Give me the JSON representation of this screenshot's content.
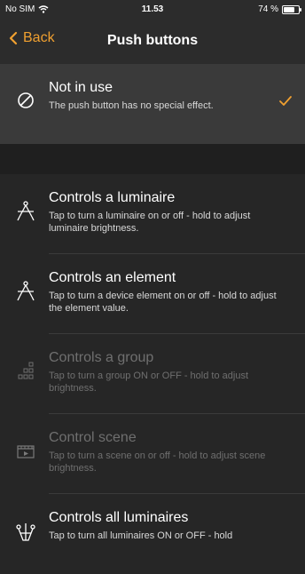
{
  "status_bar": {
    "carrier": "No SIM",
    "time": "11.53",
    "battery_text": "74 %",
    "battery_level": 0.74
  },
  "nav": {
    "back_label": "Back",
    "title": "Push buttons"
  },
  "options": [
    {
      "title": "Not in use",
      "subtitle": "The push button has no special effect.",
      "icon": "not-in-use-icon",
      "selected": true,
      "enabled": true
    },
    {
      "title": "Controls a luminaire",
      "subtitle": "Tap to turn a luminaire on or off - hold to adjust luminaire brightness.",
      "icon": "luminaire-icon",
      "selected": false,
      "enabled": true
    },
    {
      "title": "Controls an element",
      "subtitle": "Tap to turn a device element on or off - hold to adjust the element value.",
      "icon": "element-icon",
      "selected": false,
      "enabled": true
    },
    {
      "title": "Controls a group",
      "subtitle": "Tap to turn a group ON or OFF - hold to adjust brightness.",
      "icon": "group-icon",
      "selected": false,
      "enabled": false
    },
    {
      "title": "Control scene",
      "subtitle": "Tap to turn a scene on or off - hold to adjust scene brightness.",
      "icon": "scene-icon",
      "selected": false,
      "enabled": false
    },
    {
      "title": "Controls all luminaires",
      "subtitle": "Tap to turn all luminaires ON or OFF - hold",
      "icon": "all-luminaires-icon",
      "selected": false,
      "enabled": true
    }
  ],
  "colors": {
    "accent": "#f0a030",
    "background": "#262626",
    "selected_row": "#3a3a3a"
  }
}
